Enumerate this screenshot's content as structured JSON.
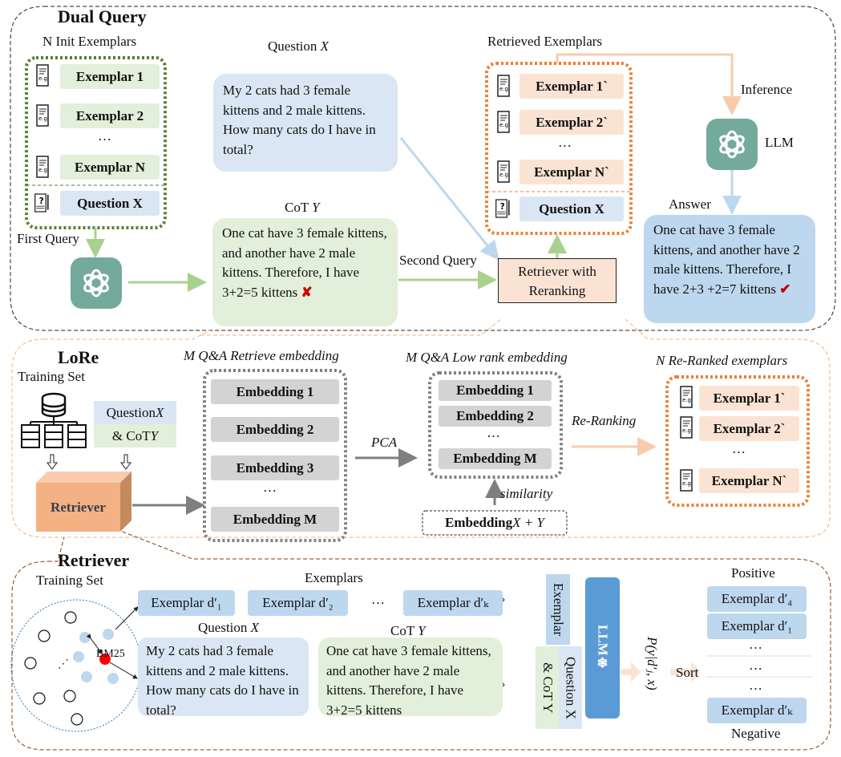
{
  "dual_query": {
    "title": "Dual Query",
    "init_label": "N Init Exemplars",
    "init_items": [
      "Exemplar 1",
      "Exemplar 2",
      "…",
      "Exemplar N"
    ],
    "question_chip": "Question X",
    "first_query": "First Query",
    "question_heading": "Question ",
    "question_var": "X",
    "question_text": "My 2 cats had 3 female kittens and 2 male kittens. How many cats do I have in total?",
    "cot_heading": "CoT ",
    "cot_var": "Y",
    "cot_text": "One cat have 3 female kittens, and another have 2 male kittens. Therefore, I have 3+2=5 kittens",
    "wrong_mark": "✘",
    "second_query": "Second Query",
    "retriever_box": "Retriever with Reranking",
    "retrieved_label": "Retrieved Exemplars",
    "retrieved_items": [
      "Exemplar 1`",
      "Exemplar 2`",
      "…",
      "Exemplar N`"
    ],
    "retrieved_question": "Question X",
    "inference": "Inference",
    "llm": "LLM",
    "answer_label": "Answer",
    "answer_text": "One cat have 3 female kittens, and another have 2 male kittens. Therefore, I have 2+3 +2=7 kittens",
    "right_mark": "✔"
  },
  "lore": {
    "title": "LoRe",
    "training_set": "Training Set",
    "qx": "Question ",
    "qx_var": "X",
    "cy": "& CoT ",
    "cy_var": "Y",
    "retriever": "Retriever",
    "retrieve_emb_label": "M Q&A Retrieve embedding",
    "retrieve_embs": [
      "Embedding 1",
      "Embedding 2",
      "Embedding 3",
      "…",
      "Embedding M"
    ],
    "pca": "PCA",
    "lowrank_label": "M Q&A Low rank embedding",
    "lowrank_embs": [
      "Embedding 1",
      "Embedding 2",
      "…",
      "Embedding M"
    ],
    "similarity": "similarity",
    "emb_xy": "Embedding ",
    "emb_xy_var": "X + Y",
    "reranking": "Re-Ranking",
    "reranked_label": "N Re-Ranked exemplars",
    "reranked_items": [
      "Exemplar 1`",
      "Exemplar 2`",
      "…",
      "Exemplar N`"
    ]
  },
  "retriever": {
    "title": "Retriever",
    "training_set": "Training Set",
    "bm25": "BM25",
    "exemplars_label": "Exemplars",
    "exemplars": [
      "Exemplar d′₁",
      "Exemplar d′₂",
      "…",
      "Exemplar d′ₖ"
    ],
    "question_heading": "Question ",
    "question_var": "X",
    "question_text": "My 2 cats had 3 female kittens and 2 male kittens. How many cats do I have in total?",
    "cot_heading": "CoT ",
    "cot_var": "Y",
    "cot_text": "One cat have 3 female kittens, and another have 2 male kittens. Therefore, I have 3+2=5 kittens",
    "v_exemplar": "Exemplar",
    "v_question": "Question X",
    "v_cot": "& CoT Y",
    "llm": "LLM❄",
    "prob": "P(y|d′ⱼ, x)",
    "sort": "Sort",
    "positive": "Positive",
    "negative": "Negative",
    "sorted": [
      "Exemplar d′₄",
      "Exemplar d′₁",
      "…",
      "…",
      "…",
      "Exemplar d′ₖ"
    ]
  }
}
